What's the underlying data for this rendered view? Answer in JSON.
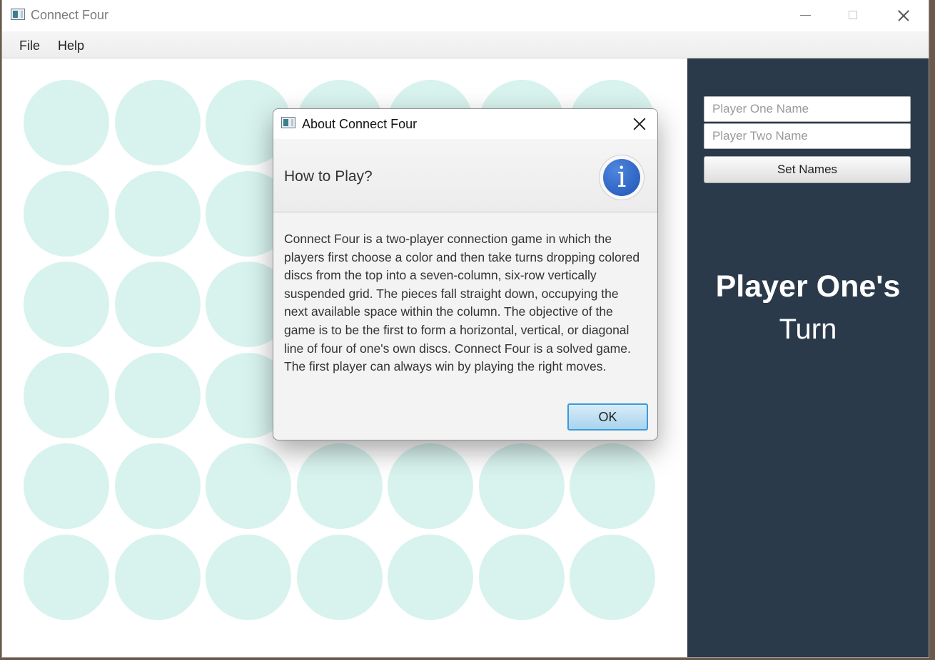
{
  "window": {
    "title": "Connect Four"
  },
  "menubar": {
    "items": [
      "File",
      "Help"
    ]
  },
  "board": {
    "columns": 7,
    "rows": 6,
    "empty_cell_color": "#d8f3ee"
  },
  "sidepanel": {
    "background": "#2b3a4b",
    "player_one_placeholder": "Player One Name",
    "player_two_placeholder": "Player Two Name",
    "set_names_label": "Set Names",
    "turn_player": "Player One's",
    "turn_word": "Turn"
  },
  "dialog": {
    "title": "About Connect Four",
    "heading": "How to Play?",
    "info_icon": "information-icon",
    "info_glyph": "i",
    "body": "Connect Four is a two-player connection game in which the players first choose a color and then take turns dropping colored discs from the top into a seven-column, six-row vertically suspended grid. The pieces fall straight down, occupying the next available space within the column. The objective of the game is to be the first to form a horizontal, vertical, or diagonal line of four of one's own discs. Connect Four is a solved game. The first player can always win by playing the right moves.",
    "ok_label": "OK"
  }
}
